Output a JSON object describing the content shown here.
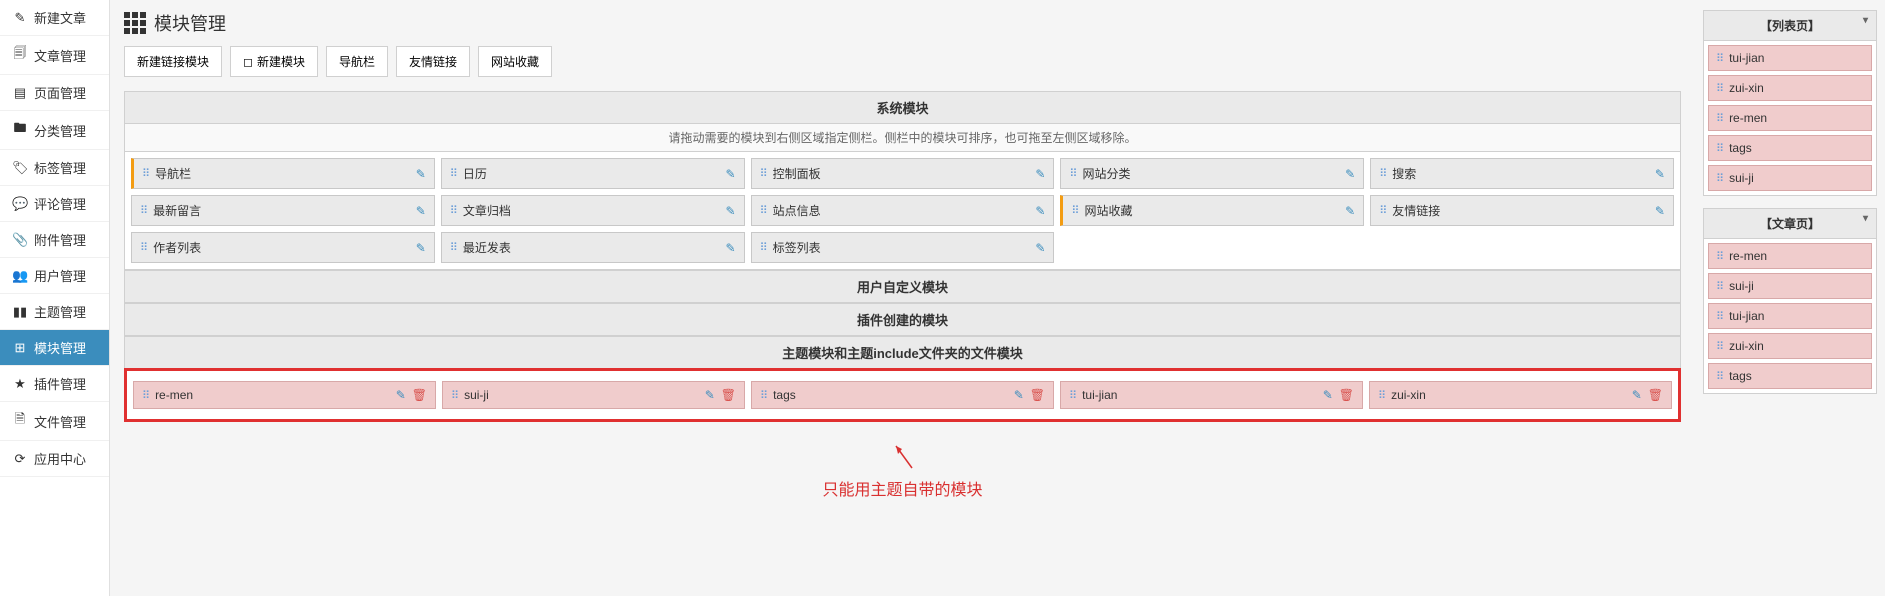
{
  "sidebar": {
    "items": [
      {
        "icon": "✎",
        "label": "新建文章"
      },
      {
        "icon": "🗐",
        "label": "文章管理"
      },
      {
        "icon": "▤",
        "label": "页面管理"
      },
      {
        "icon": "🖿",
        "label": "分类管理"
      },
      {
        "icon": "🏷",
        "label": "标签管理"
      },
      {
        "icon": "💬",
        "label": "评论管理"
      },
      {
        "icon": "📎",
        "label": "附件管理"
      },
      {
        "icon": "👥",
        "label": "用户管理"
      },
      {
        "icon": "▮▮",
        "label": "主题管理"
      },
      {
        "icon": "⊞",
        "label": "模块管理",
        "active": true
      },
      {
        "icon": "★",
        "label": "插件管理"
      },
      {
        "icon": "🗎",
        "label": "文件管理"
      },
      {
        "icon": "⟳",
        "label": "应用中心"
      }
    ]
  },
  "page": {
    "title": "模块管理"
  },
  "toolbar": {
    "new_link_module": "新建链接模块",
    "new_module": "新建模块",
    "nav": "导航栏",
    "friend_links": "友情链接",
    "favorites": "网站收藏"
  },
  "sections": {
    "system": {
      "title": "系统模块",
      "desc": "请拖动需要的模块到右侧区域指定侧栏。侧栏中的模块可排序，也可拖至左侧区域移除。",
      "cols": [
        [
          {
            "label": "导航栏",
            "orange": true
          },
          {
            "label": "最新留言"
          },
          {
            "label": "作者列表"
          }
        ],
        [
          {
            "label": "日历"
          },
          {
            "label": "文章归档"
          },
          {
            "label": "最近发表"
          }
        ],
        [
          {
            "label": "控制面板"
          },
          {
            "label": "站点信息"
          },
          {
            "label": "标签列表"
          }
        ],
        [
          {
            "label": "网站分类"
          },
          {
            "label": "网站收藏",
            "orange": true
          }
        ],
        [
          {
            "label": "搜索"
          },
          {
            "label": "友情链接"
          }
        ]
      ]
    },
    "user": {
      "title": "用户自定义模块"
    },
    "plugin": {
      "title": "插件创建的模块"
    },
    "theme": {
      "title": "主题模块和主题include文件夹的文件模块",
      "items": [
        {
          "label": "re-men"
        },
        {
          "label": "sui-ji"
        },
        {
          "label": "tags"
        },
        {
          "label": "tui-jian"
        },
        {
          "label": "zui-xin"
        }
      ]
    }
  },
  "annotation": {
    "text": "只能用主题自带的模块"
  },
  "right": {
    "panel1": {
      "title": "【列表页】",
      "items": [
        "tui-jian",
        "zui-xin",
        "re-men",
        "tags",
        "sui-ji"
      ]
    },
    "panel2": {
      "title": "【文章页】",
      "items": [
        "re-men",
        "sui-ji",
        "tui-jian",
        "zui-xin",
        "tags"
      ]
    }
  }
}
